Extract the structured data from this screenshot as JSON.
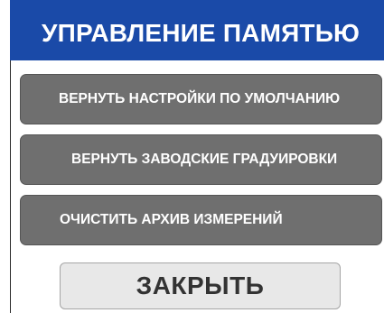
{
  "header": {
    "title": "УПРАВЛЕНИЕ ПАМЯТЬЮ"
  },
  "menu": {
    "items": [
      {
        "label": "ВЕРНУТЬ НАСТРОЙКИ ПО УМОЛЧАНИЮ"
      },
      {
        "label": "ВЕРНУТЬ ЗАВОДСКИЕ ГРАДУИРОВКИ"
      },
      {
        "label": "ОЧИСТИТЬ АРХИВ ИЗМЕРЕНИЙ"
      }
    ]
  },
  "footer": {
    "close_label": "ЗАКРЫТЬ"
  },
  "colors": {
    "header_bg": "#1a4aa8",
    "menu_button_bg": "#6f6f6f",
    "close_button_bg": "#e8e8e8"
  }
}
